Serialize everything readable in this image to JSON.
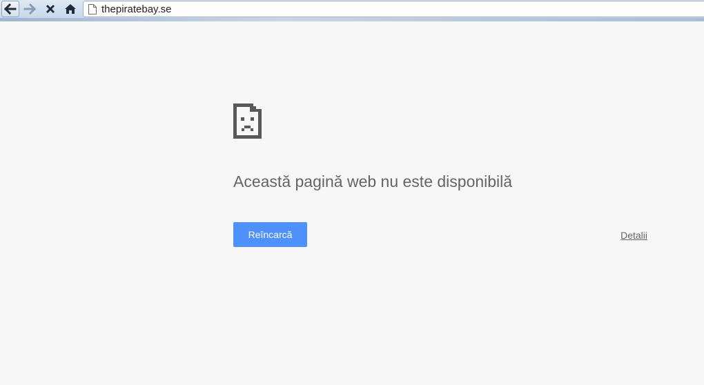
{
  "browser": {
    "url": "thepiratebay.se",
    "icons": {
      "back": "back-arrow-icon",
      "forward": "forward-arrow-icon",
      "stop": "stop-x-icon",
      "home": "home-icon",
      "page": "page-icon"
    }
  },
  "error_page": {
    "icon": "sad-page-icon",
    "title": "Această pagină web nu este disponibilă",
    "reload_label": "Reîncarcă",
    "details_label": "Detalii",
    "accent_color": "#4d90fe",
    "text_color": "#646464"
  }
}
